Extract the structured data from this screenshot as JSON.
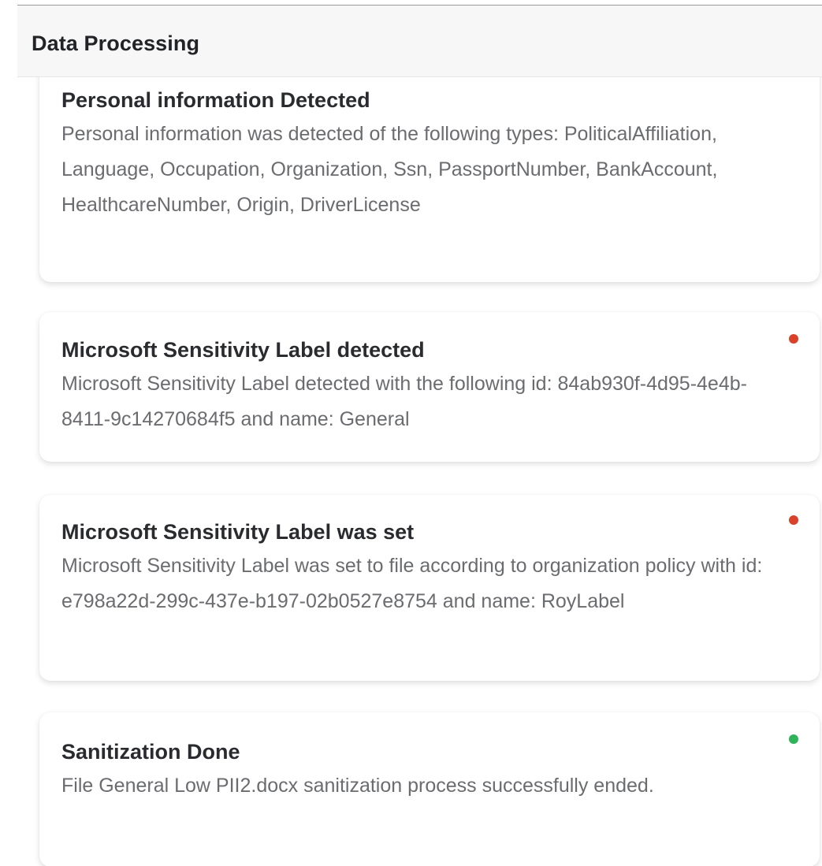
{
  "header": {
    "title": "Data Processing"
  },
  "events": [
    {
      "title": "Personal information Detected",
      "body": "Personal information was detected of the following types: PoliticalAffiliation, Language, Occupation, Organization, Ssn, PassportNumber, BankAccount, HealthcareNumber, Origin, DriverLicense",
      "status": "neutral"
    },
    {
      "title": "Microsoft Sensitivity Label detected",
      "body": "Microsoft Sensitivity Label detected with the following id: 84ab930f-4d95-4e4b-8411-9c14270684f5 and name: General",
      "status": "alert"
    },
    {
      "title": "Microsoft Sensitivity Label was set",
      "body": "Microsoft Sensitivity Label was set to file according to organization policy with id: e798a22d-299c-437e-b197-02b0527e8754 and name: RoyLabel",
      "status": "alert"
    },
    {
      "title": "Sanitization Done",
      "body": "File General Low PII2.docx sanitization process successfully ended.",
      "status": "success"
    }
  ],
  "colors": {
    "alert": "#d9412b",
    "success": "#2fb35a",
    "neutral": "#9a9a9a"
  }
}
